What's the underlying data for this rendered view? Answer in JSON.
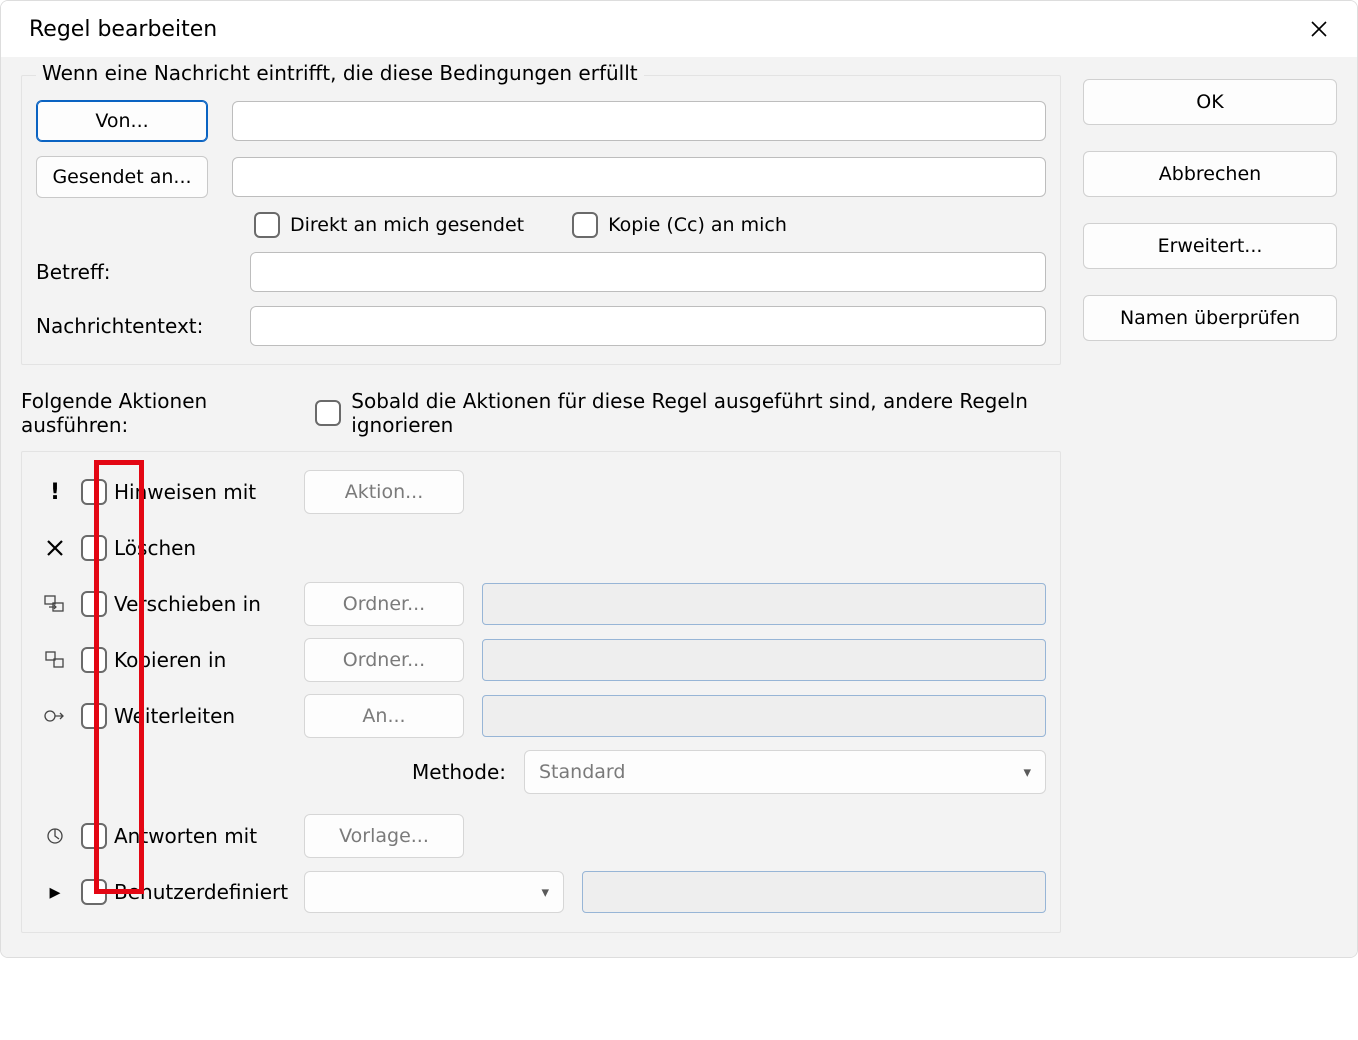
{
  "title": "Regel bearbeiten",
  "conditions": {
    "legend": "Wenn eine Nachricht eintrifft, die diese Bedingungen erfüllt",
    "from_btn": "Von...",
    "sent_to_btn": "Gesendet an...",
    "direct_to_me": "Direkt an mich gesendet",
    "cc_to_me": "Kopie (Cc) an mich",
    "subject_label": "Betreff:",
    "body_label": "Nachrichtentext:"
  },
  "actions_header": "Folgende Aktionen ausführen:",
  "stop_processing": "Sobald die Aktionen für diese Regel ausgeführt sind, andere Regeln ignorieren",
  "actions": {
    "alert": "Hinweisen mit",
    "alert_btn": "Aktion...",
    "delete": "Löschen",
    "move": "Verschieben in",
    "move_btn": "Ordner...",
    "copy": "Kopieren in",
    "copy_btn": "Ordner...",
    "forward": "Weiterleiten",
    "forward_btn": "An...",
    "method_label": "Methode:",
    "method_value": "Standard",
    "reply": "Antworten mit",
    "reply_btn": "Vorlage...",
    "custom": "Benutzerdefiniert"
  },
  "buttons": {
    "ok": "OK",
    "cancel": "Abbrechen",
    "advanced": "Erweitert...",
    "check_names": "Namen überprüfen"
  }
}
